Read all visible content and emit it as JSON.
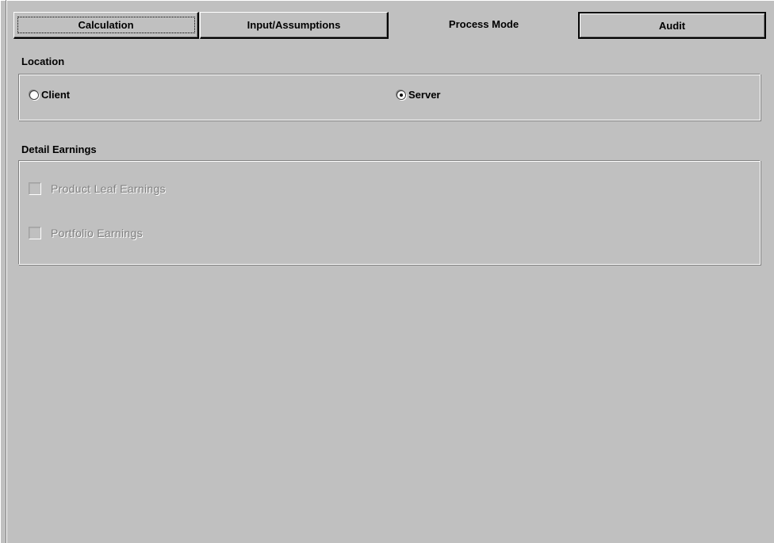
{
  "tabs": [
    {
      "label": "Calculation"
    },
    {
      "label": "Input/Assumptions"
    },
    {
      "label": "Process Mode"
    },
    {
      "label": "Audit"
    }
  ],
  "location": {
    "title": "Location",
    "options": [
      {
        "label": "Client",
        "checked": false
      },
      {
        "label": "Server",
        "checked": true
      }
    ]
  },
  "detail_earnings": {
    "title": "Detail Earnings",
    "options": [
      {
        "label": "Product Leaf Earnings",
        "checked": false,
        "enabled": false
      },
      {
        "label": "Portfolio Earnings",
        "checked": false,
        "enabled": false
      }
    ]
  }
}
